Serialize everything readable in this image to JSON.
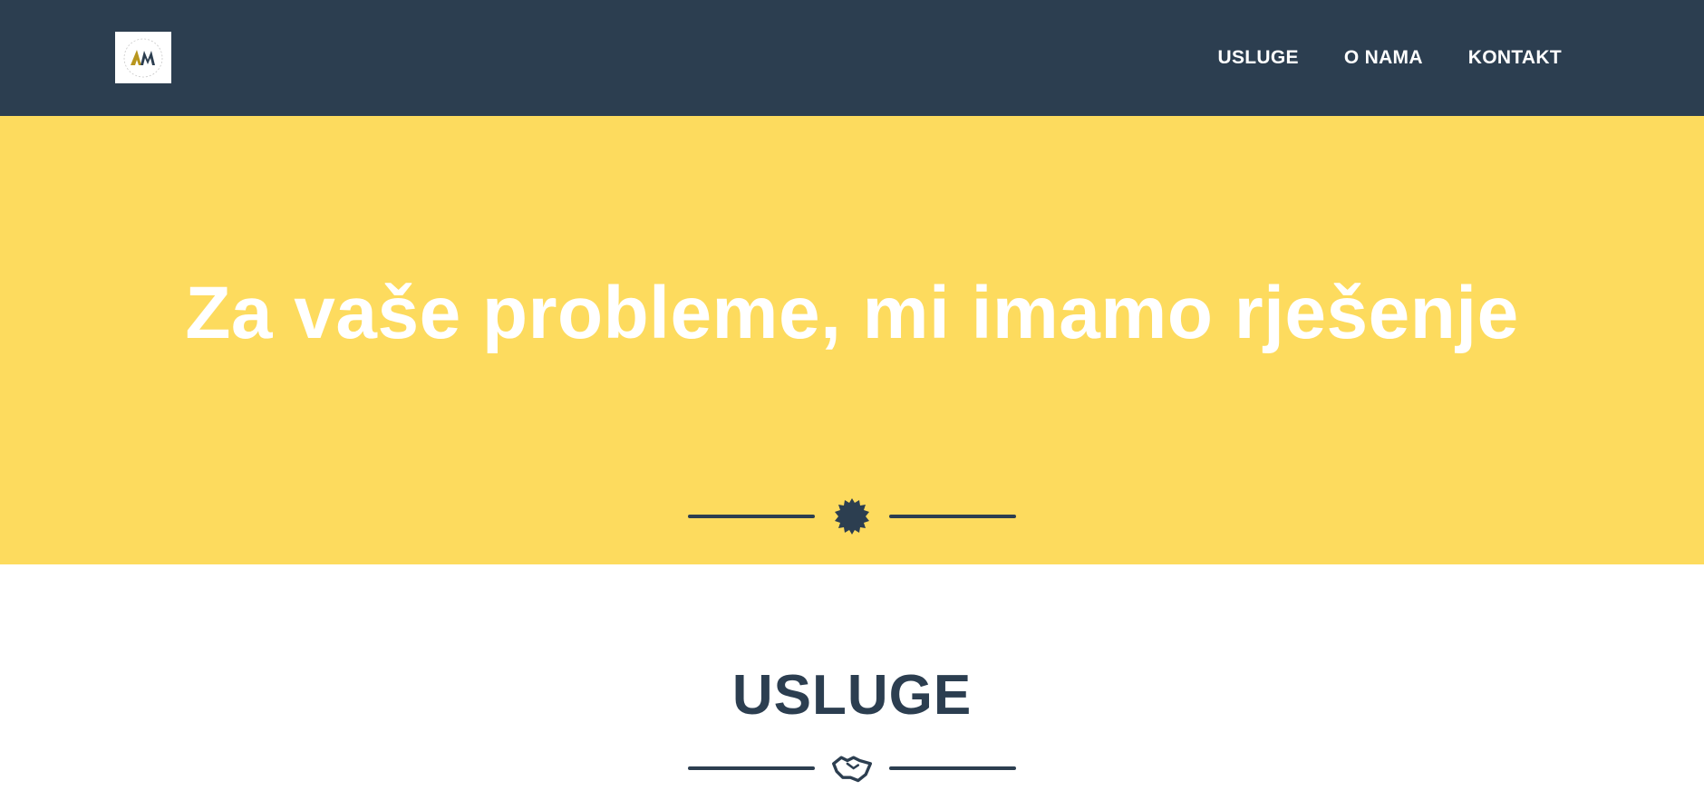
{
  "navbar": {
    "logo_text": "AM",
    "links": [
      {
        "label": "USLUGE"
      },
      {
        "label": "O NAMA"
      },
      {
        "label": "KONTAKT"
      }
    ]
  },
  "hero": {
    "title": "Za vaše probleme, mi imamo rješenje",
    "divider_icon": "star-badge-icon"
  },
  "services": {
    "title": "USLUGE",
    "divider_icon": "handshake-icon"
  },
  "colors": {
    "navbar_bg": "#2c3e50",
    "hero_bg": "#fddb5e",
    "text_dark": "#2c3e50",
    "text_light": "#ffffff"
  }
}
